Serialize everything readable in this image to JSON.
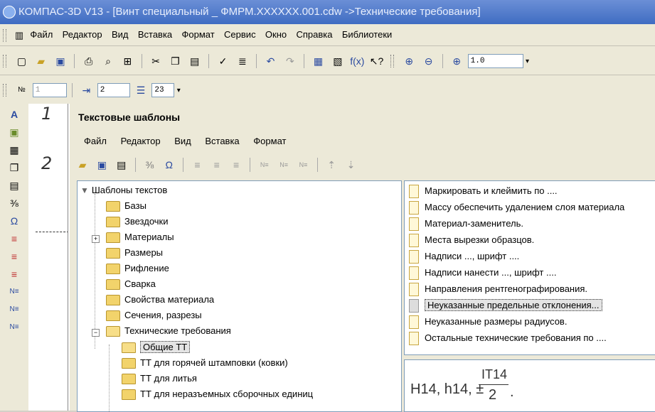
{
  "window": {
    "title": "КОМПАС-3D V13 - [Винт специальный _ ФМРМ.XXXXXX.001.cdw ->Технические требования]"
  },
  "menu": [
    "Файл",
    "Редактор",
    "Вид",
    "Вставка",
    "Формат",
    "Сервис",
    "Окно",
    "Справка",
    "Библиотеки"
  ],
  "toolbar": {
    "zoom": "1.0"
  },
  "toolbar2": {
    "field1": "1",
    "field2": "2",
    "field3": "23"
  },
  "drawing": {
    "label1": "1",
    "label2": "2"
  },
  "dialog": {
    "title": "Текстовые шаблоны",
    "menu": [
      "Файл",
      "Редактор",
      "Вид",
      "Вставка",
      "Формат"
    ]
  },
  "tree": {
    "root": "Шаблоны текстов",
    "items": [
      "Базы",
      "Звездочки",
      "Материалы",
      "Размеры",
      "Рифление",
      "Сварка",
      "Свойства материала",
      "Сечения, разрезы",
      "Технические требования"
    ],
    "children": [
      "Общие ТТ",
      "ТТ для горячей штамповки (ковки)",
      "ТТ для литья",
      "ТТ для неразъемных сборочных единиц"
    ]
  },
  "list": [
    "Маркировать и клеймить по ....",
    "Массу обеспечить удалением слоя материала",
    "Материал-заменитель.",
    "Места вырезки образцов.",
    "Надписи ..., шрифт ....",
    "Надписи нанести ..., шрифт ....",
    "Направления рентгенографирования.",
    "Неуказанные предельные отклонения...",
    "Неуказанные размеры радиусов.",
    "Остальные технические требования по ...."
  ],
  "preview": {
    "text": "H14, h14, ±",
    "numerator": "IT14",
    "denominator": "2"
  }
}
